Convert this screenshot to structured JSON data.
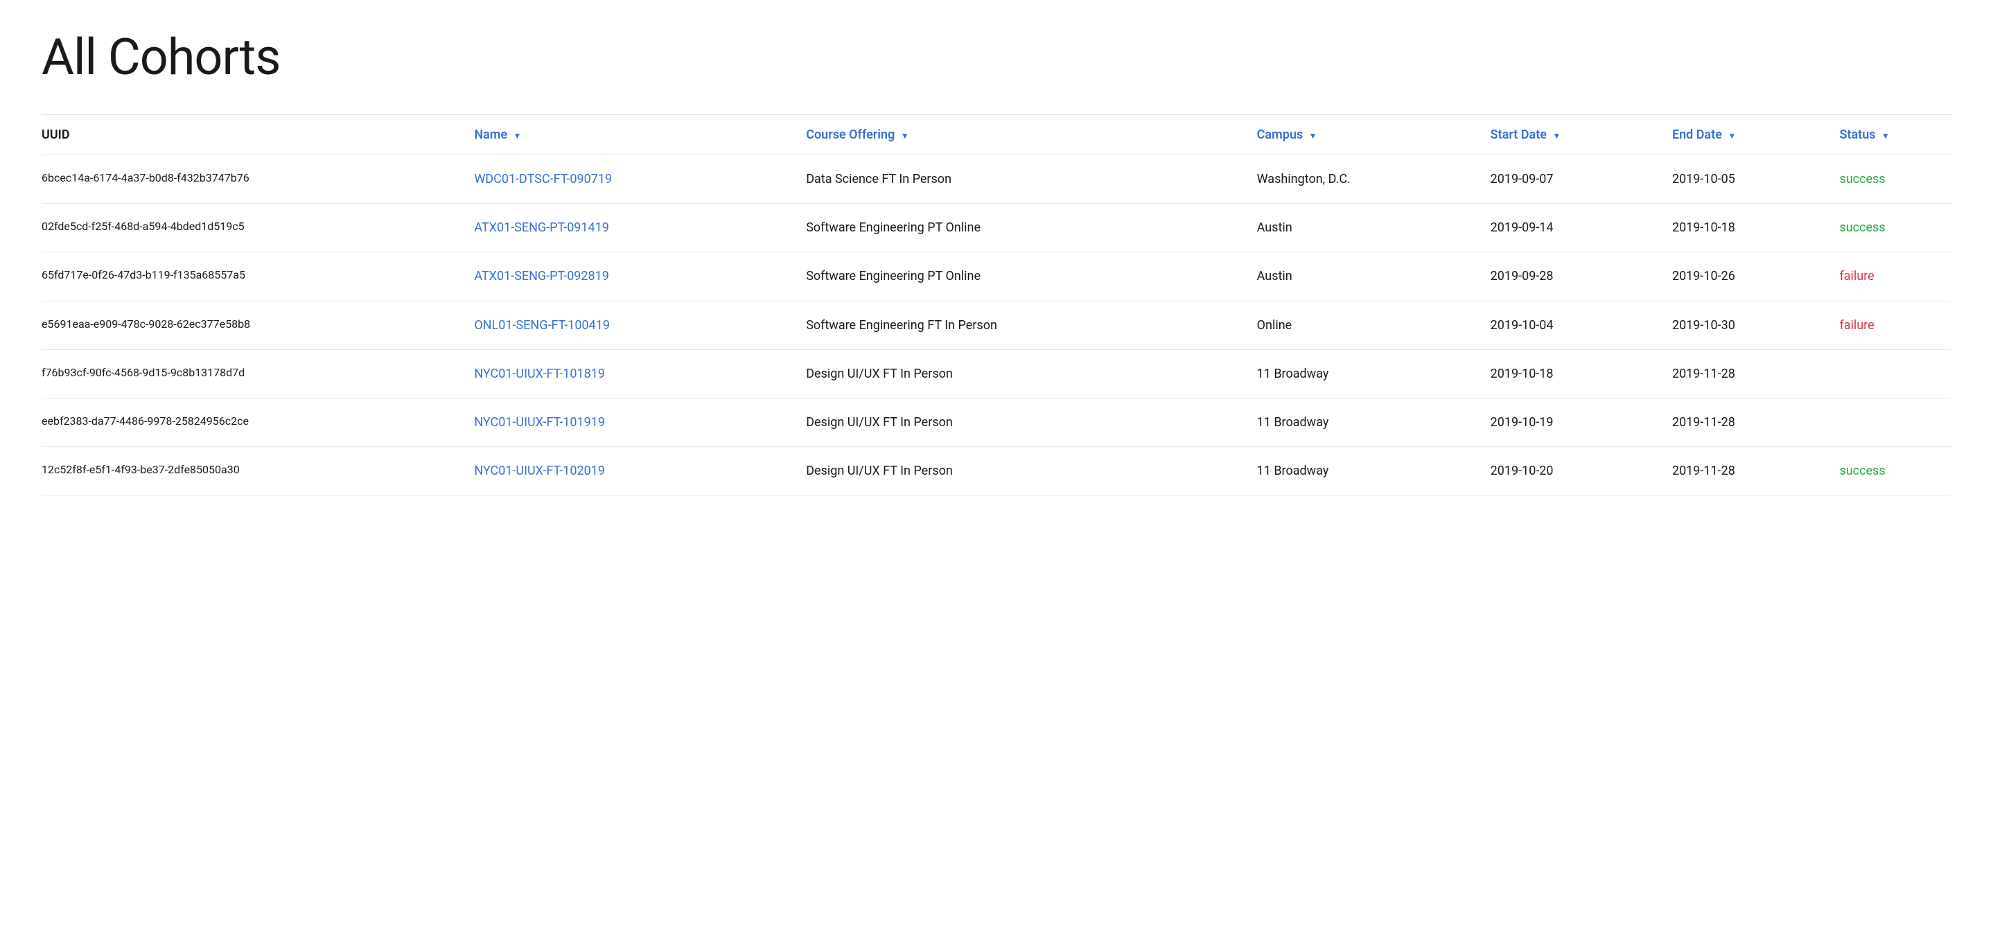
{
  "page": {
    "title": "All Cohorts"
  },
  "table": {
    "columns": [
      {
        "key": "uuid",
        "label": "UUID",
        "sortable": false
      },
      {
        "key": "name",
        "label": "Name",
        "sortable": true
      },
      {
        "key": "course_offering",
        "label": "Course Offering",
        "sortable": true
      },
      {
        "key": "campus",
        "label": "Campus",
        "sortable": true
      },
      {
        "key": "start_date",
        "label": "Start Date",
        "sortable": true
      },
      {
        "key": "end_date",
        "label": "End Date",
        "sortable": true
      },
      {
        "key": "status",
        "label": "Status",
        "sortable": true
      }
    ],
    "rows": [
      {
        "uuid": "6bcec14a-6174-4a37-b0d8-f432b3747b76",
        "name": "WDC01-DTSC-FT-090719",
        "course_offering": "Data Science FT In Person",
        "campus": "Washington, D.C.",
        "start_date": "2019-09-07",
        "end_date": "2019-10-05",
        "status": "success"
      },
      {
        "uuid": "02fde5cd-f25f-468d-a594-4bded1d519c5",
        "name": "ATX01-SENG-PT-091419",
        "course_offering": "Software Engineering PT Online",
        "campus": "Austin",
        "start_date": "2019-09-14",
        "end_date": "2019-10-18",
        "status": "success"
      },
      {
        "uuid": "65fd717e-0f26-47d3-b119-f135a68557a5",
        "name": "ATX01-SENG-PT-092819",
        "course_offering": "Software Engineering PT Online",
        "campus": "Austin",
        "start_date": "2019-09-28",
        "end_date": "2019-10-26",
        "status": "failure"
      },
      {
        "uuid": "e5691eaa-e909-478c-9028-62ec377e58b8",
        "name": "ONL01-SENG-FT-100419",
        "course_offering": "Software Engineering FT In Person",
        "campus": "Online",
        "start_date": "2019-10-04",
        "end_date": "2019-10-30",
        "status": "failure"
      },
      {
        "uuid": "f76b93cf-90fc-4568-9d15-9c8b13178d7d",
        "name": "NYC01-UIUX-FT-101819",
        "course_offering": "Design UI/UX FT In Person",
        "campus": "11 Broadway",
        "start_date": "2019-10-18",
        "end_date": "2019-11-28",
        "status": ""
      },
      {
        "uuid": "eebf2383-da77-4486-9978-25824956c2ce",
        "name": "NYC01-UIUX-FT-101919",
        "course_offering": "Design UI/UX FT In Person",
        "campus": "11 Broadway",
        "start_date": "2019-10-19",
        "end_date": "2019-11-28",
        "status": ""
      },
      {
        "uuid": "12c52f8f-e5f1-4f93-be37-2dfe85050a30",
        "name": "NYC01-UIUX-FT-102019",
        "course_offering": "Design UI/UX FT In Person",
        "campus": "11 Broadway",
        "start_date": "2019-10-20",
        "end_date": "2019-11-28",
        "status": "success"
      }
    ]
  }
}
